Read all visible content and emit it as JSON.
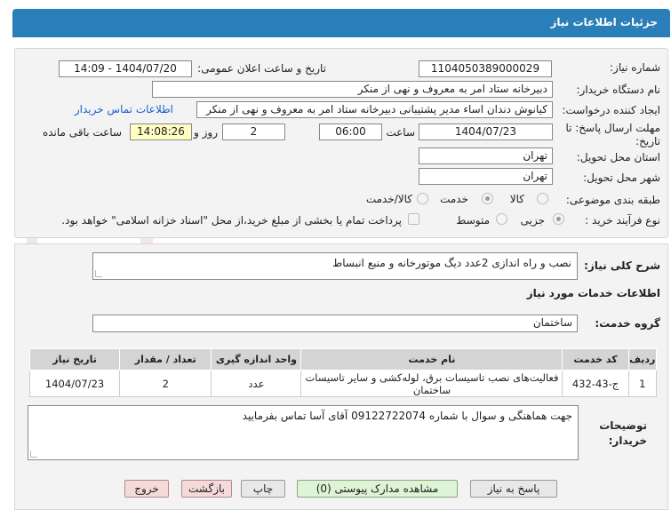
{
  "header": {
    "title": "جزئیات اطلاعات نیاز"
  },
  "form": {
    "need_number_label": "شماره نیاز:",
    "need_number": "1104050389000029",
    "announce_label": "تاریخ و ساعت اعلان عمومی:",
    "announce_value": "1404/07/20 - 14:09",
    "buyer_org_label": "نام دستگاه خریدار:",
    "buyer_org": "دبیرخانه ستاد امر به معروف و نهی از منکر",
    "requester_label": "ایجاد کننده درخواست:",
    "requester": "کیانوش دندان اساء مدیر پشتیبانی دبیرخانه ستاد امر به معروف و نهی از منکر",
    "contact_link": "اطلاعات تماس خریدار",
    "deadline_label_1": "مهلت ارسال پاسخ: تا",
    "deadline_label_2": "تاریخ:",
    "deadline_date": "1404/07/23",
    "time_label": "ساعت",
    "deadline_time": "06:00",
    "days_value": "2",
    "days_label": "روز و",
    "remaining_time": "14:08:26",
    "remaining_label": "ساعت باقی مانده",
    "province_label": "استان محل تحویل:",
    "province": "تهران",
    "city_label": "شهر محل تحویل:",
    "city": "تهران",
    "category_label": "طبقه بندی موضوعی:",
    "category_options": [
      "کالا",
      "خدمت",
      "کالا/خدمت"
    ],
    "process_label": "نوع فرآیند خرید :",
    "process_options": [
      "جزیی",
      "متوسط"
    ],
    "payment_note": "پرداخت تمام یا بخشی از مبلغ خرید،از محل \"اسناد خزانه اسلامی\" خواهد بود."
  },
  "details": {
    "summary_label": "شرح کلی نیاز:",
    "summary": "نصب و راه اندازی 2عدد دیگ موتورخانه و منبع انبساط",
    "services_heading": "اطلاعات خدمات مورد نیاز",
    "service_group_label": "گروه خدمت:",
    "service_group": "ساختمان"
  },
  "table": {
    "headers": [
      "ردیف",
      "کد خدمت",
      "نام خدمت",
      "واحد اندازه گیری",
      "تعداد / مقدار",
      "تاریخ نیاز"
    ],
    "rows": [
      [
        "1",
        "ج-43-432",
        "فعالیت‌های نصب تاسیسات برق، لوله‌کشی و سایر تاسیسات ساختمان",
        "عدد",
        "2",
        "1404/07/23"
      ]
    ]
  },
  "notes": {
    "label_1": "توضیحات",
    "label_2": "خریدار:",
    "text": "جهت هماهنگی و سوال با شماره 09122722074 آقای آسا تماس بفرمایید"
  },
  "buttons": {
    "reply": "پاسخ به نیاز",
    "attachments": "مشاهده مدارک پیوستی (0)",
    "print": "چاپ",
    "back": "بازگشت",
    "exit": "خروج"
  },
  "watermark": {
    "text": "AriaTender.net"
  }
}
